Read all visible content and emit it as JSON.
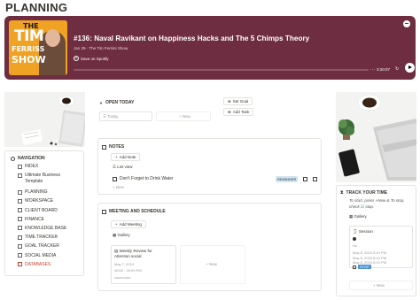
{
  "page": {
    "title": "PLANNING"
  },
  "spotify": {
    "cover": {
      "line1": "THE",
      "line2": "TIM",
      "line3": "FERRISS",
      "line4": "SHOW"
    },
    "episode_title": "#136: Naval Ravikant on Happiness Hacks and The 5 Chimps Theory",
    "meta": "Jan 29 · The Tim Ferriss Show",
    "save_label": "Save on Spotify",
    "time": "3:20:07",
    "progress": 0.0,
    "colors": {
      "background": "#6e2d40",
      "cover": "#f0a224"
    }
  },
  "open_today": {
    "label": "OPEN TODAY",
    "today_label": "Today",
    "new_label": "New"
  },
  "actions": {
    "set_goal": "Set Goal",
    "add_task": "Add Task"
  },
  "navigation": {
    "heading": "NAVIGATION",
    "items": [
      {
        "label": "INDEX"
      },
      {
        "label": "Ultimate Business Template"
      },
      {
        "label": "PLANNING"
      },
      {
        "label": "WORKSPACE"
      },
      {
        "label": "CLIENT BOARD"
      },
      {
        "label": "FINANCE"
      },
      {
        "label": "KNOWLEDGE BASE"
      },
      {
        "label": "TIME TRACKER"
      },
      {
        "label": "GOAL TRACKER"
      },
      {
        "label": "SOCIAL MEDIA"
      },
      {
        "label": "DATABASES"
      }
    ]
  },
  "notes": {
    "heading": "NOTES",
    "add_label": "Add Note",
    "view_label": "List view",
    "row": {
      "title": "Don't Forget to Drink Water",
      "tag": "REMINDER"
    },
    "new_label": "New"
  },
  "meeting": {
    "heading": "MEETING AND SCHEDULE",
    "add_label": "Add Meeting",
    "view_label": "Gallery",
    "card": {
      "title": "Weekly Review for Attention social",
      "date": "May 7, 2024",
      "time": "06:00 - 09:00 PM",
      "link": "zoom.com"
    },
    "new_label": "New"
  },
  "tracker": {
    "heading": "TRACK YOUR TIME",
    "instructions": "To start, press +New & To stop, check",
    "stop_word": "stop.",
    "view_label": "Gallery",
    "card": {
      "title": "Session",
      "sub": "No",
      "start": "May 8, 2024 8:10 PM",
      "end1": "May 8, 2024 8:10 PM",
      "end2": "May 8, 2024 8:10 PM",
      "stop_label": "STOP"
    },
    "new_label": "New"
  }
}
